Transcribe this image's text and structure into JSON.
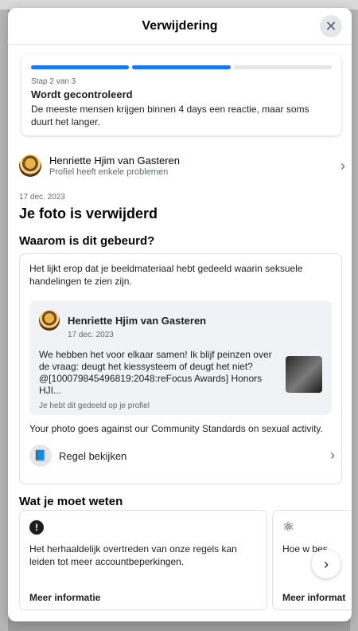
{
  "modal": {
    "title": "Verwijdering",
    "close_icon": "close-icon"
  },
  "progress": {
    "segments_filled": 2,
    "segments_total": 3,
    "step": "Stap 2 van 3",
    "title": "Wordt gecontroleerd",
    "description": "De meeste mensen krijgen binnen 4 days een reactie, maar soms duurt het langer.",
    "accent": "#1877f2"
  },
  "account": {
    "name": "Henriette Hjim van Gasteren",
    "subtitle": "Profiel heeft enkele problemen"
  },
  "violation": {
    "date": "17 dec. 2023",
    "headline": "Je foto is verwijderd",
    "why_heading": "Waarom is dit gebeurd?",
    "why_text": "Het lijkt erop dat je beeldmateriaal hebt gedeeld waarin seksuele handelingen te zien zijn.",
    "post": {
      "author": "Henriette Hjim van Gasteren",
      "date": "17 dec. 2023",
      "text": "We hebben het voor elkaar samen! Ik blijf peinzen over de vraag: deugt het kiessysteem of deugt het niet? @[100079845496819:2048:reFocus Awards] Honors HJI...",
      "shared_note": "Je hebt dit gedeeld op je profiel"
    },
    "policy_text": "Your photo goes against our Community Standards on sexual activity.",
    "rule_label": "Regel bekijken"
  },
  "know": {
    "heading": "Wat je moet weten",
    "cards": [
      {
        "icon": "alert-icon",
        "text": "Het herhaaldelijk overtreden van onze regels kan leiden tot meer accountbeperkingen.",
        "link": "Meer informatie"
      },
      {
        "icon": "meta-ai-icon",
        "text": "Hoe w bes",
        "link": "Meer informat"
      }
    ]
  }
}
